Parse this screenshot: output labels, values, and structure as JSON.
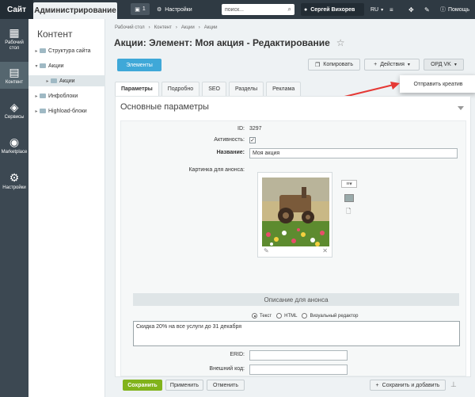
{
  "topbar": {
    "site": "Сайт",
    "admin": "Администрирование",
    "badge_count": "1",
    "settings": "Настройки",
    "search_placeholder": "поиск...",
    "user": "Сергей Вихорев",
    "lang": "RU",
    "help": "Помощь"
  },
  "leftnav": [
    {
      "label": "Рабочий стол",
      "icon": "desktop-icon"
    },
    {
      "label": "Контент",
      "icon": "content-icon"
    },
    {
      "label": "Сервисы",
      "icon": "services-icon"
    },
    {
      "label": "Marketplace",
      "icon": "marketplace-icon"
    },
    {
      "label": "Настройки",
      "icon": "gear-icon"
    }
  ],
  "sidebar": {
    "title": "Контент",
    "items": [
      {
        "label": "Структура сайта"
      },
      {
        "label": "Акции"
      },
      {
        "label": "Акции"
      },
      {
        "label": "Инфоблоки"
      },
      {
        "label": "Highload-блоки"
      }
    ]
  },
  "breadcrumbs": [
    "Рабочий стол",
    "Контент",
    "Акции",
    "Акции"
  ],
  "page_title": "Акции: Элемент: Моя акция - Редактирование",
  "toolbar": {
    "elements": "Элементы",
    "copy": "Копировать",
    "actions": "Действия",
    "ord": "ОРД VK",
    "dropdown_item": "Отправить креатив"
  },
  "tabs": [
    "Параметры",
    "Подробно",
    "SEO",
    "Разделы",
    "Реклама"
  ],
  "section_title": "Основные параметры",
  "form": {
    "id_label": "ID:",
    "id_value": "3297",
    "active_label": "Активность:",
    "name_label": "Название:",
    "name_value": "Моя акция",
    "picture_label": "Картинка для анонса:",
    "desc_header": "Описание для анонса",
    "radio_text": "Текст",
    "radio_html": "HTML",
    "radio_visual": "Визуальный редактор",
    "desc_value": "Скидка 20% на все услуги до 31 декабря",
    "erid_label": "ERID:",
    "ext_code_label": "Внешний код:"
  },
  "footer": {
    "save": "Сохранить",
    "apply": "Применить",
    "cancel": "Отменить",
    "save_add": "Сохранить и добавить"
  },
  "colors": {
    "accent": "#3fa8d8",
    "save": "#81b31b",
    "arrow": "#e53935"
  }
}
